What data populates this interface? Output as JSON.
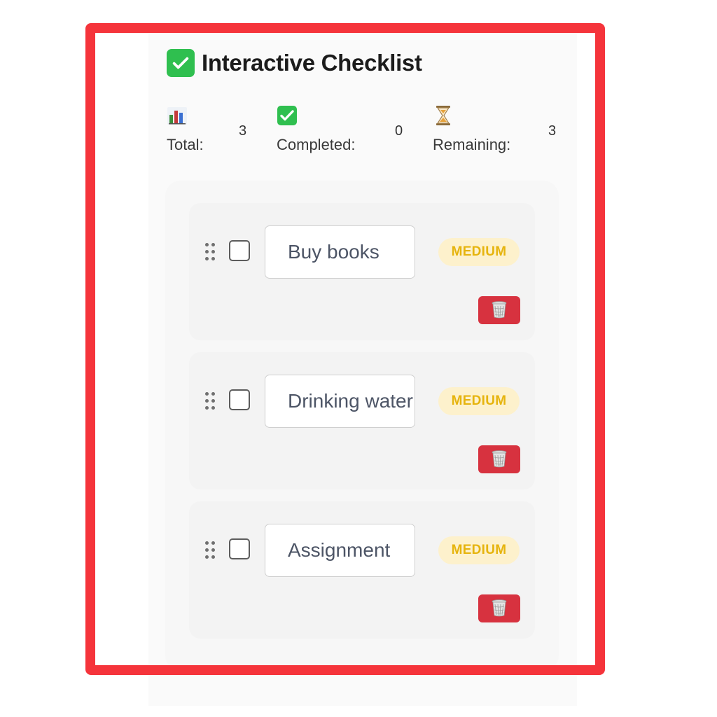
{
  "header": {
    "title": "Interactive Checklist",
    "icon": "check-mark-button-icon"
  },
  "stats": [
    {
      "icon": "bar-chart-icon",
      "label": "Total:",
      "value": "3"
    },
    {
      "icon": "check-mark-button-icon",
      "label": "Completed:",
      "value": "0"
    },
    {
      "icon": "hourglass-icon",
      "label": "Remaining:",
      "value": "3"
    }
  ],
  "items": [
    {
      "text": "Buy books",
      "priority": "MEDIUM",
      "checked": false
    },
    {
      "text": "Drinking water",
      "priority": "MEDIUM",
      "checked": false
    },
    {
      "text": "Assignment",
      "priority": "MEDIUM",
      "checked": false
    }
  ],
  "colors": {
    "accent_green": "#2fbf4f",
    "priority_medium_bg": "#fdf1cc",
    "priority_medium_text": "#e6b40e",
    "delete_red": "#d7323f",
    "frame_red": "#f5343b"
  }
}
